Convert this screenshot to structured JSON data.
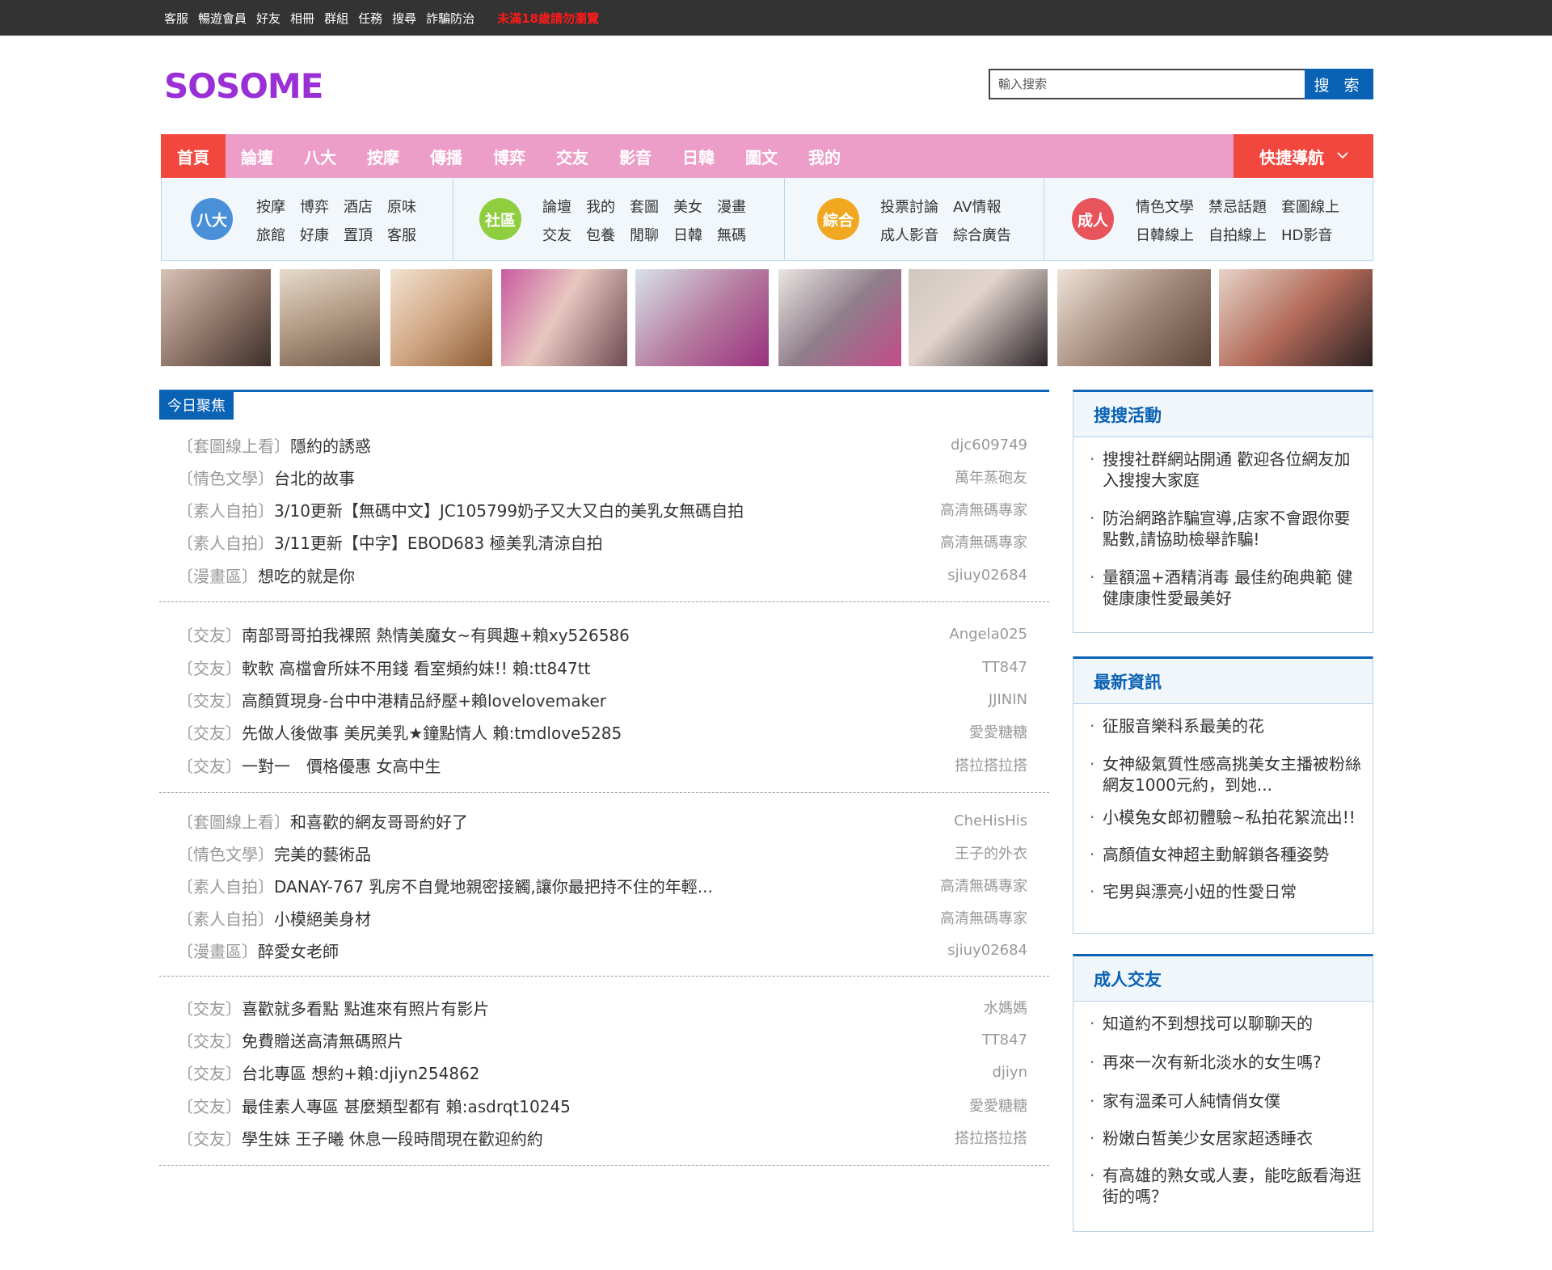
{
  "topbar": {
    "links": [
      "客服",
      "暢遊會員",
      "好友",
      "相冊",
      "群組",
      "任務",
      "搜尋",
      "詐騙防治"
    ],
    "warning": "未滿18歲請勿瀏覽"
  },
  "logo": "SOSOME",
  "search": {
    "placeholder": "輸入搜索",
    "button": "搜 索"
  },
  "nav": {
    "items": [
      "首頁",
      "論壇",
      "八大",
      "按摩",
      "傳播",
      "博弈",
      "交友",
      "影音",
      "日韓",
      "圖文",
      "我的"
    ],
    "quick": "快捷導航"
  },
  "categories": [
    {
      "badge": "八大",
      "color": "#4a90d9",
      "links": [
        "按摩",
        "博弈",
        "酒店",
        "原味",
        "旅館",
        "好康",
        "置頂",
        "客服"
      ]
    },
    {
      "badge": "社區",
      "color": "#8fce3e",
      "links": [
        "論壇",
        "我的",
        "套圖",
        "美女",
        "漫畫",
        "交友",
        "包養",
        "閒聊",
        "日韓",
        "無碼"
      ]
    },
    {
      "badge": "綜合",
      "color": "#f0a820",
      "links": [
        "投票討論",
        "AV情報",
        "成人影音",
        "綜合廣告"
      ]
    },
    {
      "badge": "成人",
      "color": "#e8545c",
      "links": [
        "情色文學",
        "禁忌話題",
        "套圖線上",
        "日韓線上",
        "自拍線上",
        "HD影音"
      ]
    }
  ],
  "focus": {
    "tab": "今日聚焦",
    "groups": [
      [
        {
          "cat": "〔套圖線上看〕",
          "title": "隱約的誘惑",
          "author": "djc609749"
        },
        {
          "cat": "〔情色文學〕",
          "title": "台北的故事",
          "author": "萬年蒸砲友"
        },
        {
          "cat": "〔素人自拍〕",
          "title": "3/10更新【無碼中文】JC105799奶子又大又白的美乳女無碼自拍",
          "author": "高清無碼專家"
        },
        {
          "cat": "〔素人自拍〕",
          "title": "3/11更新【中字】EBOD683 極美乳清涼自拍",
          "author": "高清無碼專家"
        },
        {
          "cat": "〔漫畫區〕",
          "title": "想吃的就是你",
          "author": "sjiuy02684"
        }
      ],
      [
        {
          "cat": "〔交友〕",
          "title": "南部哥哥拍我裸照 熱情美魔女~有興趣+賴xy526586",
          "author": "Angela025"
        },
        {
          "cat": "〔交友〕",
          "title": "軟軟 高檔會所妹不用錢 看室頻約妹!! 賴:tt847tt",
          "author": "TT847"
        },
        {
          "cat": "〔交友〕",
          "title": "高顏質現身-台中中港精品紓壓+賴lovelovemaker",
          "author": "JJININ"
        },
        {
          "cat": "〔交友〕",
          "title": "先做人後做事 美尻美乳★鐘點情人 賴:tmdlove5285",
          "author": "愛愛糖糖"
        },
        {
          "cat": "〔交友〕",
          "title": "一對一　價格優惠 女高中生",
          "author": "搭拉搭拉搭"
        }
      ],
      [
        {
          "cat": "〔套圖線上看〕",
          "title": "和喜歡的網友哥哥約好了",
          "author": "CheHisHis"
        },
        {
          "cat": "〔情色文學〕",
          "title": "完美的藝術品",
          "author": "王子的外衣"
        },
        {
          "cat": "〔素人自拍〕",
          "title": "DANAY-767 乳房不自覺地親密接觸,讓你最把持不住的年輕...",
          "author": "高清無碼專家"
        },
        {
          "cat": "〔素人自拍〕",
          "title": "小模絕美身材",
          "author": "高清無碼專家"
        },
        {
          "cat": "〔漫畫區〕",
          "title": "醉愛女老師",
          "author": "sjiuy02684"
        }
      ],
      [
        {
          "cat": "〔交友〕",
          "title": "喜歡就多看點 點進來有照片有影片",
          "author": "水媽媽"
        },
        {
          "cat": "〔交友〕",
          "title": "免費贈送高清無碼照片",
          "author": "TT847"
        },
        {
          "cat": "〔交友〕",
          "title": "台北專區 想約+賴:djiyn254862",
          "author": "djiyn"
        },
        {
          "cat": "〔交友〕",
          "title": "最佳素人專區 甚麼類型都有 賴:asdrqt10245",
          "author": "愛愛糖糖"
        },
        {
          "cat": "〔交友〕",
          "title": "學生妹 王子曦 休息一段時間現在歡迎約約",
          "author": "搭拉搭拉搭"
        }
      ]
    ]
  },
  "sidebar": [
    {
      "title": "搜搜活動",
      "items": [
        "搜搜社群網站開通 歡迎各位網友加入搜搜大家庭",
        "防治網路詐騙宣導,店家不會跟你要點數,請協助檢舉詐騙!",
        "量額溫+酒精消毒 最佳約砲典範 健健康康性愛最美好"
      ]
    },
    {
      "title": "最新資訊",
      "items": [
        "征服音樂科系最美的花",
        "女神級氣質性感高挑美女主播被粉絲網友1000元約，到她...",
        "小模兔女郎初體驗~私拍花絮流出!!",
        "高顏值女神超主動解鎖各種姿勢",
        "宅男與漂亮小妞的性愛日常"
      ]
    },
    {
      "title": "成人交友",
      "items": [
        "知道約不到想找可以聊聊天的",
        " 再來一次有新北淡水的女生嗎?",
        "家有溫柔可人純情俏女僕",
        "粉嫩白皙美少女居家超透睡衣",
        "有高雄的熟女或人妻，能吃飯看海逛街的嗎？"
      ]
    }
  ]
}
